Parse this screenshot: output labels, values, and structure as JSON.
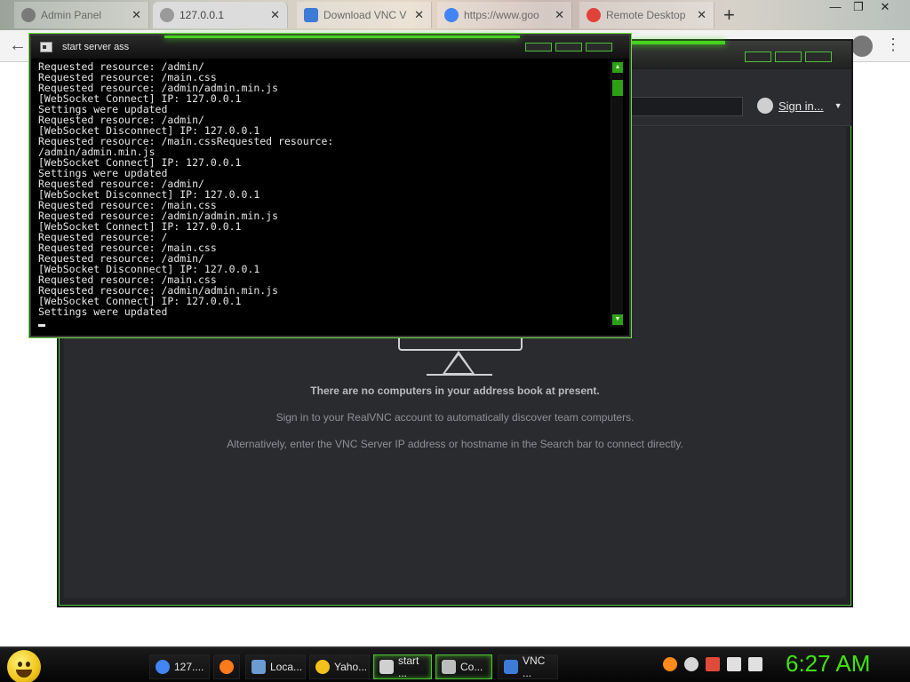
{
  "browser": {
    "tabs": [
      {
        "label": "Admin Panel",
        "favicon_color": "#7a7a7a"
      },
      {
        "label": "127.0.0.1",
        "favicon_color": "#9a9a9a"
      },
      {
        "label": "Download VNC V",
        "favicon_color": "#3d7bd8"
      },
      {
        "label": "https://www.goo",
        "favicon_color": "#4285f4"
      },
      {
        "label": "Remote Desktop",
        "favicon_color": "#e0423a"
      }
    ],
    "new_tab_glyph": "+",
    "window_controls": [
      "—",
      "❐",
      "✕"
    ]
  },
  "vnc_viewer": {
    "sign_in_label": "Sign in...",
    "empty_heading": "There are no computers in your address book at present.",
    "hint_1": "Sign in to your RealVNC account to automatically discover team computers.",
    "hint_2": "Alternatively, enter the VNC Server IP address or hostname in the Search bar to connect directly.",
    "accent_color": "#4fbf3a"
  },
  "console": {
    "title": "start server ass",
    "lines": [
      "Requested resource: /admin/",
      "Requested resource: /main.css",
      "Requested resource: /admin/admin.min.js",
      "[WebSocket Connect] IP: 127.0.0.1",
      "Settings were updated",
      "Requested resource: /admin/",
      "[WebSocket Disconnect] IP: 127.0.0.1",
      "Requested resource: /main.cssRequested resource:",
      "/admin/admin.min.js",
      "[WebSocket Connect] IP: 127.0.0.1",
      "Settings were updated",
      "Requested resource: /admin/",
      "[WebSocket Disconnect] IP: 127.0.0.1",
      "Requested resource: /main.css",
      "Requested resource: /admin/admin.min.js",
      "[WebSocket Connect] IP: 127.0.0.1",
      "Requested resource: /",
      "Requested resource: /main.css",
      "Requested resource: /admin/",
      "[WebSocket Disconnect] IP: 127.0.0.1",
      "Requested resource: /main.css",
      "Requested resource: /admin/admin.min.js",
      "[WebSocket Connect] IP: 127.0.0.1",
      "Settings were updated"
    ]
  },
  "taskbar": {
    "items": [
      {
        "label": "127....",
        "icon_color": "#4285f4"
      },
      {
        "label": "",
        "icon_color": "#ff7a1a"
      },
      {
        "label": "Loca...",
        "icon_color": "#6b9bd1"
      },
      {
        "label": "Yaho...",
        "icon_color": "#f2c21b"
      },
      {
        "label": "start ...",
        "icon_color": "#d0d0d0"
      },
      {
        "label": "Co...",
        "icon_color": "#bcbcbc"
      },
      {
        "label": "VNC ...",
        "icon_color": "#3d7bd8"
      }
    ],
    "clock": "6:27 AM",
    "clock_color": "#3fe40f"
  }
}
